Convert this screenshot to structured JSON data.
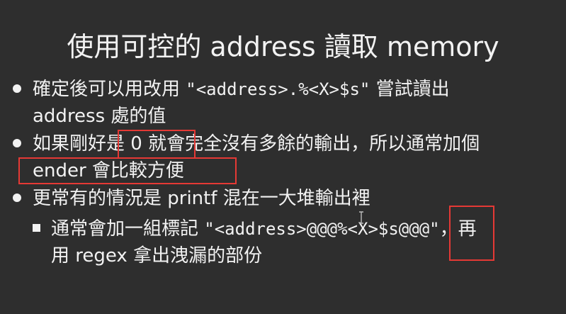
{
  "slide": {
    "title": "使用可控的 address 讀取 memory",
    "bullets": [
      {
        "line1_prefix": "確定後可以用改用 ",
        "line1_code": "\"<address>.%<X>$s\"",
        "line1_suffix": " 嘗試讀出",
        "line2": "address 處的值"
      },
      {
        "line1": "如果剛好是 0 就會完全沒有多餘的輸出，所以通常加個",
        "line2": "ender 會比較方便"
      },
      {
        "line1": "更常有的情況是 printf 混在一大堆輸出裡",
        "sub": {
          "line1_prefix": "通常會加一組標記 ",
          "line1_code": "\"<address>@@@%<X>$s@@@\"",
          "line1_suffix": "，再",
          "line2": "用 regex 拿出洩漏的部份"
        }
      }
    ],
    "highlight_color": "#e53935"
  }
}
